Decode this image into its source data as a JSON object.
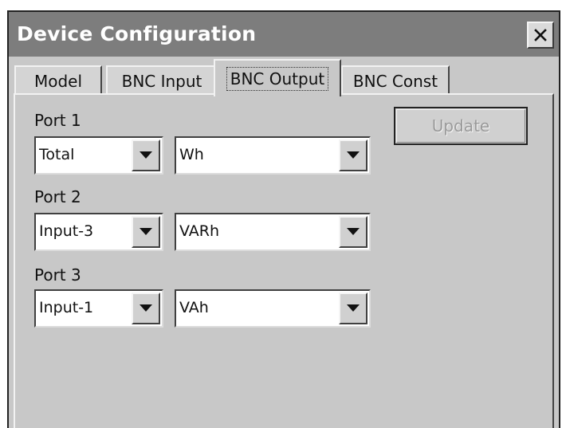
{
  "window": {
    "title": "Device Configuration"
  },
  "tabs": [
    {
      "label": "Model"
    },
    {
      "label": "BNC Input"
    },
    {
      "label": "BNC Output"
    },
    {
      "label": "BNC Const"
    }
  ],
  "active_tab": "BNC Output",
  "ports": [
    {
      "label": "Port 1",
      "source": "Total",
      "unit": "Wh"
    },
    {
      "label": "Port 2",
      "source": "Input-3",
      "unit": "VARh"
    },
    {
      "label": "Port 3",
      "source": "Input-1",
      "unit": "VAh"
    }
  ],
  "update_button": {
    "label": "Update",
    "enabled": false
  },
  "icons": {
    "close": "close-icon",
    "dropdown": "dropdown-arrow-icon"
  },
  "colors": {
    "titlebar": "#7d7d7d",
    "panel": "#c8c8c8"
  }
}
